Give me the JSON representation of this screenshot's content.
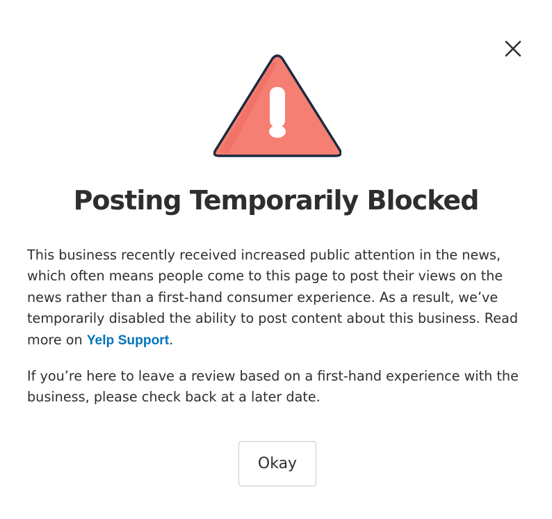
{
  "modal": {
    "close_icon": "close-icon",
    "warning_icon": "warning-triangle-icon",
    "title": "Posting Temporarily Blocked",
    "paragraph1_text": "This business recently received increased public attention in the news, which often means people come to this page to post their views on the news rather than a first-hand consumer experience. As a result, we’ve temporarily disabled the ability to post content about this business. Read more on ",
    "link_label": "Yelp Support",
    "paragraph1_end": ".",
    "paragraph2_text": "If you’re here to leave a review based on a first-hand experience with the business, please check back at a later date.",
    "okay_label": "Okay"
  },
  "colors": {
    "warning_fill": "#f47f72",
    "warning_outline": "#1b2a3f",
    "link": "#0073bb",
    "text": "#2d2e2f",
    "button_border": "#c8c9ca"
  }
}
